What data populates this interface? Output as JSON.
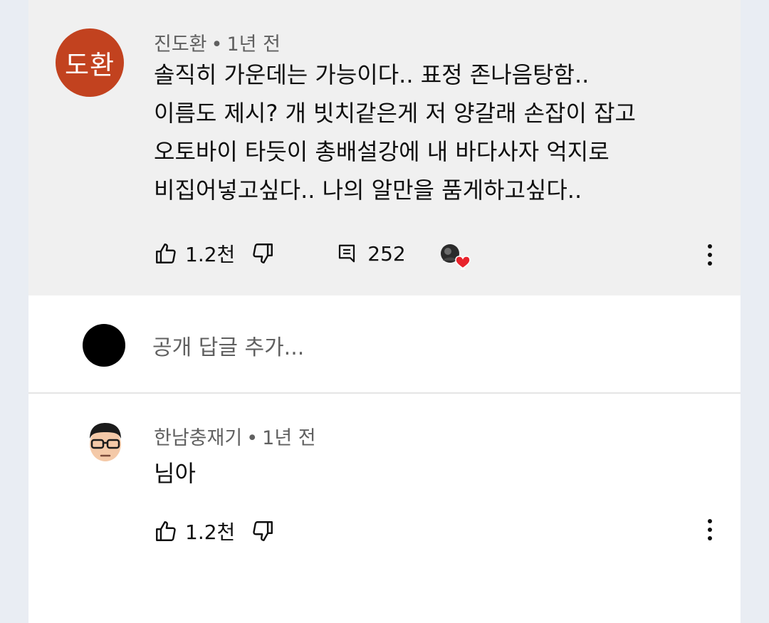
{
  "comment": {
    "avatar_text": "도환",
    "author": "진도환",
    "time": "1년 전",
    "lines": [
      "솔직히 가운데는 가능이다.. 표정 존나음탕함..",
      "이름도 제시? 개 빗치같은게 저 양갈래 손잡이 잡고",
      "오토바이 타듯이 총배설강에 내 바다사자 억지로",
      "비집어넣고싶다.. 나의 알만을 품게하고싶다.."
    ],
    "likes": "1.2천",
    "replies": "252"
  },
  "reply_box": {
    "placeholder": "공개 답글 추가..."
  },
  "reply": {
    "author": "한남충재기",
    "time": "1년 전",
    "text": "님아",
    "likes": "1.2천"
  },
  "icons": {
    "like": "thumbs-up-icon",
    "dislike": "thumbs-down-icon",
    "replies": "comment-icon",
    "more": "more-vertical-icon",
    "creator_heart": "creator-heart-icon"
  },
  "colors": {
    "avatar_bg": "#c2421f",
    "highlight_bg": "#f0f0f0",
    "heart": "#e8232c"
  }
}
